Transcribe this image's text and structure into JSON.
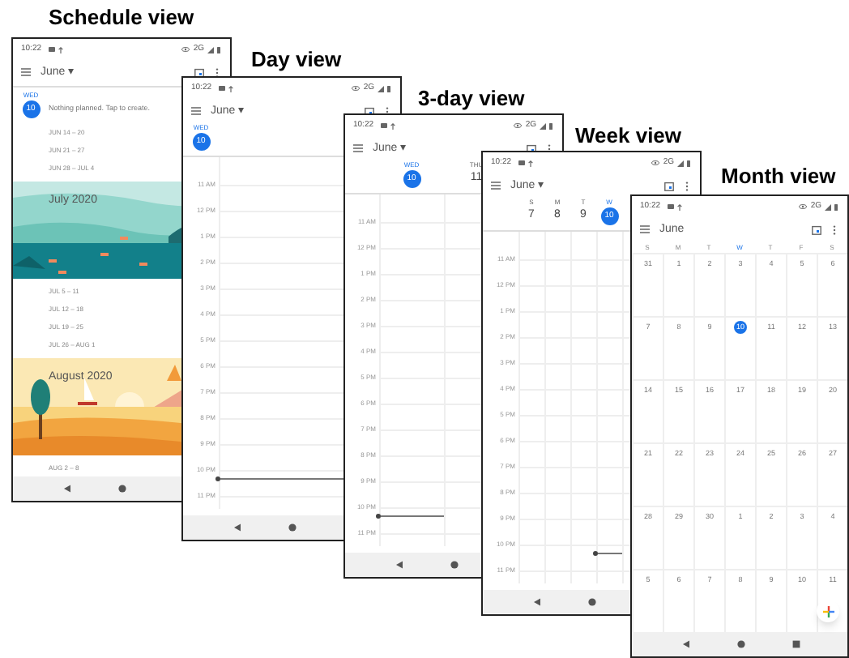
{
  "panels": [
    {
      "kind": "schedule",
      "caption": "Schedule view",
      "status": {
        "time": "10:22",
        "network": "2G"
      },
      "month_menu": {
        "label": "June",
        "caret": "▾"
      },
      "today": {
        "weekday": "WED",
        "day": "10"
      },
      "note": "Nothing planned. Tap to create.",
      "entries": [
        {
          "kind": "range",
          "text": "JUN 14 – 20"
        },
        {
          "kind": "range",
          "text": "JUN 21 – 27"
        },
        {
          "kind": "range",
          "text": "JUN 28 – JUL 4"
        },
        {
          "kind": "banner",
          "text": "July 2020"
        },
        {
          "kind": "range",
          "text": "JUL 5 – 11"
        },
        {
          "kind": "range",
          "text": "JUL 12 – 18"
        },
        {
          "kind": "range",
          "text": "JUL 19 – 25"
        },
        {
          "kind": "range",
          "text": "JUL 26 – AUG 1"
        },
        {
          "kind": "banner",
          "text": "August 2020"
        },
        {
          "kind": "range",
          "text": "AUG 2 – 8"
        }
      ]
    },
    {
      "kind": "day",
      "caption": "Day view",
      "status": {
        "time": "10:22",
        "network": "2G"
      },
      "month_menu": {
        "label": "June",
        "caret": "▾"
      },
      "days": [
        {
          "weekday": "WED",
          "day": "10",
          "selected": true
        }
      ],
      "hours": [
        "11 AM",
        "12 PM",
        "1 PM",
        "2 PM",
        "3 PM",
        "4 PM",
        "5 PM",
        "6 PM",
        "7 PM",
        "8 PM",
        "9 PM",
        "10 PM",
        "11 PM"
      ]
    },
    {
      "kind": "threeday",
      "caption": "3-day view",
      "status": {
        "time": "10:22",
        "network": "2G"
      },
      "month_menu": {
        "label": "June",
        "caret": "▾"
      },
      "days": [
        {
          "weekday": "WED",
          "day": "10",
          "selected": true
        },
        {
          "weekday": "THU",
          "day": "11",
          "selected": false
        }
      ],
      "hours": [
        "11 AM",
        "12 PM",
        "1 PM",
        "2 PM",
        "3 PM",
        "4 PM",
        "5 PM",
        "6 PM",
        "7 PM",
        "8 PM",
        "9 PM",
        "10 PM",
        "11 PM"
      ]
    },
    {
      "kind": "week",
      "caption": "Week view",
      "status": {
        "time": "10:22",
        "network": "2G"
      },
      "month_menu": {
        "label": "June",
        "caret": "▾"
      },
      "days": [
        {
          "weekday": "S",
          "day": "7",
          "selected": false
        },
        {
          "weekday": "M",
          "day": "8",
          "selected": false
        },
        {
          "weekday": "T",
          "day": "9",
          "selected": false
        },
        {
          "weekday": "W",
          "day": "10",
          "selected": true
        }
      ],
      "hours": [
        "11 AM",
        "12 PM",
        "1 PM",
        "2 PM",
        "3 PM",
        "4 PM",
        "5 PM",
        "6 PM",
        "7 PM",
        "8 PM",
        "9 PM",
        "10 PM",
        "11 PM"
      ]
    },
    {
      "kind": "month",
      "caption": "Month view",
      "status": {
        "time": "10:22",
        "network": "2G"
      },
      "month_menu": {
        "label": "June"
      },
      "weekdays": [
        {
          "label": "S",
          "selected": false
        },
        {
          "label": "M",
          "selected": false
        },
        {
          "label": "T",
          "selected": false
        },
        {
          "label": "W",
          "selected": true
        },
        {
          "label": "T",
          "selected": false
        },
        {
          "label": "F",
          "selected": false
        },
        {
          "label": "S",
          "selected": false
        }
      ],
      "weeks": [
        [
          {
            "day": "31",
            "selected": false
          },
          {
            "day": "1",
            "selected": false
          },
          {
            "day": "2",
            "selected": false
          },
          {
            "day": "3",
            "selected": false
          },
          {
            "day": "4",
            "selected": false
          },
          {
            "day": "5",
            "selected": false
          },
          {
            "day": "6",
            "selected": false
          }
        ],
        [
          {
            "day": "7",
            "selected": false
          },
          {
            "day": "8",
            "selected": false
          },
          {
            "day": "9",
            "selected": false
          },
          {
            "day": "10",
            "selected": true
          },
          {
            "day": "11",
            "selected": false
          },
          {
            "day": "12",
            "selected": false
          },
          {
            "day": "13",
            "selected": false
          }
        ],
        [
          {
            "day": "14",
            "selected": false
          },
          {
            "day": "15",
            "selected": false
          },
          {
            "day": "16",
            "selected": false
          },
          {
            "day": "17",
            "selected": false
          },
          {
            "day": "18",
            "selected": false
          },
          {
            "day": "19",
            "selected": false
          },
          {
            "day": "20",
            "selected": false
          }
        ],
        [
          {
            "day": "21",
            "selected": false
          },
          {
            "day": "22",
            "selected": false
          },
          {
            "day": "23",
            "selected": false
          },
          {
            "day": "24",
            "selected": false
          },
          {
            "day": "25",
            "selected": false
          },
          {
            "day": "26",
            "selected": false
          },
          {
            "day": "27",
            "selected": false
          }
        ],
        [
          {
            "day": "28",
            "selected": false
          },
          {
            "day": "29",
            "selected": false
          },
          {
            "day": "30",
            "selected": false
          },
          {
            "day": "1",
            "selected": false
          },
          {
            "day": "2",
            "selected": false
          },
          {
            "day": "3",
            "selected": false
          },
          {
            "day": "4",
            "selected": false
          }
        ],
        [
          {
            "day": "5",
            "selected": false
          },
          {
            "day": "6",
            "selected": false
          },
          {
            "day": "7",
            "selected": false
          },
          {
            "day": "8",
            "selected": false
          },
          {
            "day": "9",
            "selected": false
          },
          {
            "day": "10",
            "selected": false
          },
          {
            "day": "11",
            "selected": false
          }
        ]
      ]
    }
  ]
}
